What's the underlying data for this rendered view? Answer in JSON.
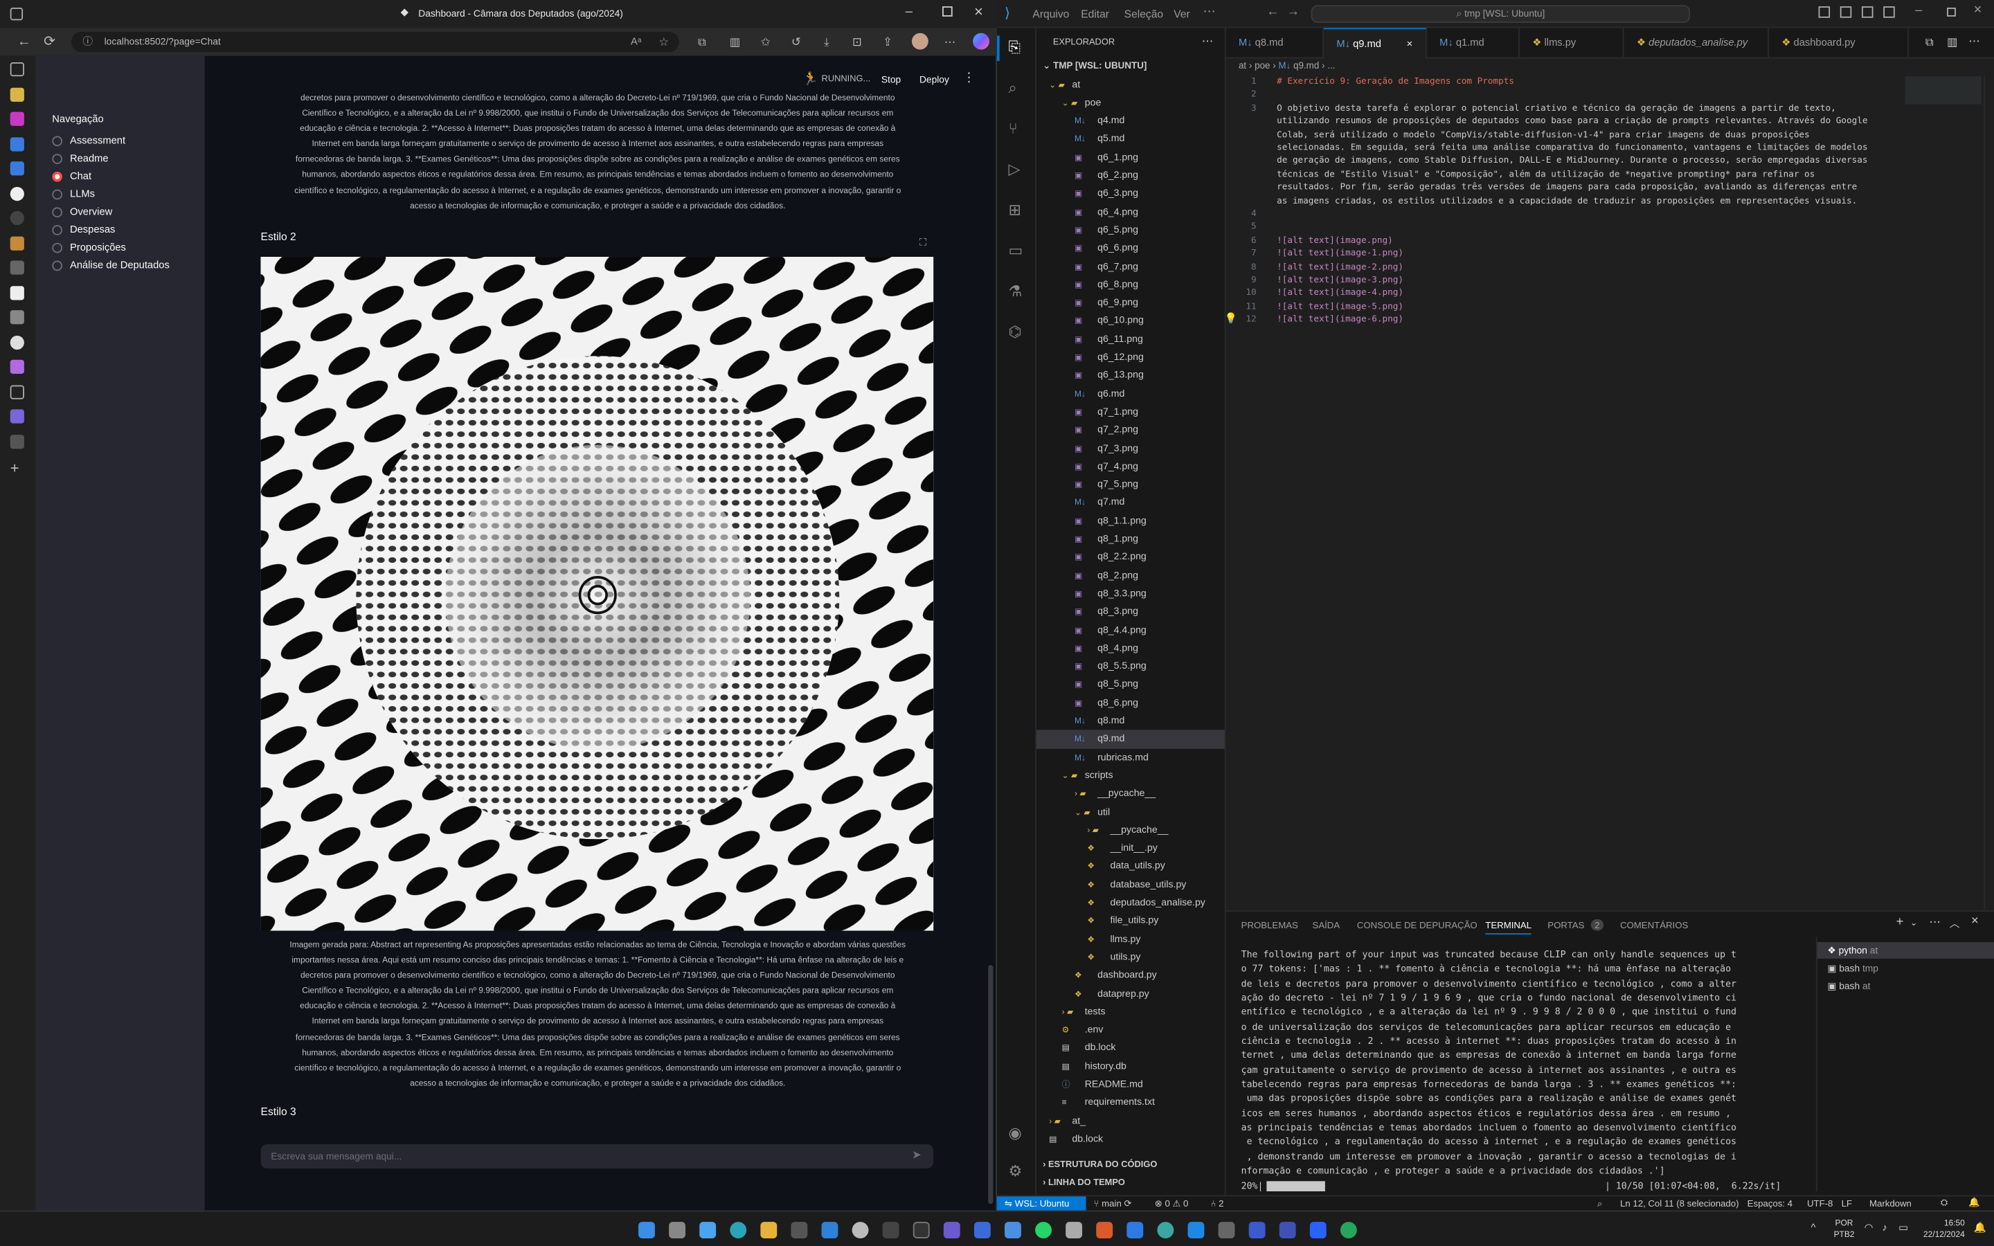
{
  "edge": {
    "title": "Dashboard - Câmara dos Deputados (ago/2024)",
    "url": "localhost:8502/?page=Chat",
    "window_controls": [
      "minimize",
      "maximize",
      "close"
    ]
  },
  "streamlit": {
    "status": "RUNNING...",
    "stop_label": "Stop",
    "deploy_label": "Deploy",
    "nav_title": "Navegação",
    "nav_items": [
      {
        "label": "Assessment",
        "selected": false
      },
      {
        "label": "Readme",
        "selected": false
      },
      {
        "label": "Chat",
        "selected": true
      },
      {
        "label": "LLMs",
        "selected": false
      },
      {
        "label": "Overview",
        "selected": false
      },
      {
        "label": "Despesas",
        "selected": false
      },
      {
        "label": "Proposições",
        "selected": false
      },
      {
        "label": "Análise de Deputados",
        "selected": false
      }
    ],
    "top_paragraph": [
      "decretos para promover o desenvolvimento científico e tecnológico, como a alteração do Decreto-Lei nº 719/1969, que cria o Fundo Nacional de Desenvolvimento",
      "Científico e Tecnológico, e a alteração da Lei nº 9.998/2000, que institui o Fundo de Universalização dos Serviços de Telecomunicações para aplicar recursos em",
      "educação e ciência e tecnologia. 2. **Acesso à Internet**: Duas proposições tratam do acesso à Internet, uma delas determinando que as empresas de conexão à",
      "Internet em banda larga forneçam gratuitamente o serviço de provimento de acesso à Internet aos assinantes, e outra estabelecendo regras para empresas",
      "fornecedoras de banda larga. 3. **Exames Genéticos**: Uma das proposições dispõe sobre as condições para a realização e análise de exames genéticos em seres",
      "humanos, abordando aspectos éticos e regulatórios dessa área. Em resumo, as principais tendências e temas abordados incluem o fomento ao desenvolvimento",
      "científico e tecnológico, a regulamentação do acesso à Internet, e a regulação de exames genéticos, demonstrando um interesse em promover a inovação, garantir o",
      "acesso a tecnologias de informação e comunicação, e proteger a saúde e a privacidade dos cidadãos."
    ],
    "section2_title": "Estilo 2",
    "caption": [
      "Imagem gerada para: Abstract art representing As proposições apresentadas estão relacionadas ao tema de Ciência, Tecnologia e Inovação e abordam várias questões",
      "importantes nessa área. Aqui está um resumo conciso das principais tendências e temas: 1. **Fomento à Ciência e Tecnologia**: Há uma ênfase na alteração de leis e",
      "decretos para promover o desenvolvimento científico e tecnológico, como a alteração do Decreto-Lei nº 719/1969, que cria o Fundo Nacional de Desenvolvimento",
      "Científico e Tecnológico, e a alteração da Lei nº 9.998/2000, que institui o Fundo de Universalização dos Serviços de Telecomunicações para aplicar recursos em",
      "educação e ciência e tecnologia. 2. **Acesso à Internet**: Duas proposições tratam do acesso à Internet, uma delas determinando que as empresas de conexão à",
      "Internet em banda larga forneçam gratuitamente o serviço de provimento de acesso à Internet aos assinantes, e outra estabelecendo regras para empresas",
      "fornecedoras de banda larga. 3. **Exames Genéticos**: Uma das proposições dispõe sobre as condições para a realização e análise de exames genéticos em seres",
      "humanos, abordando aspectos éticos e regulatórios dessa área. Em resumo, as principais tendências e temas abordados incluem o fomento ao desenvolvimento",
      "científico e tecnológico, a regulamentação do acesso à Internet, e a regulação de exames genéticos, demonstrando um interesse em promover a inovação, garantir o",
      "acesso a tecnologias de informação e comunicação, e proteger a saúde e a privacidade dos cidadãos."
    ],
    "section3_title": "Estilo 3",
    "chat_placeholder": "Escreva sua mensagem aqui..."
  },
  "vscode": {
    "menu": [
      "Arquivo",
      "Editar",
      "Seleção",
      "Ver"
    ],
    "search": "tmp [WSL: Ubuntu]",
    "explorer_title": "EXPLORADOR",
    "workspace": "TMP [WSL: UBUNTU]",
    "tree": [
      {
        "label": "at",
        "depth": 0,
        "kind": "folder-open"
      },
      {
        "label": "poe",
        "depth": 1,
        "kind": "folder-open"
      },
      {
        "label": "q4.md",
        "depth": 2,
        "kind": "md"
      },
      {
        "label": "q5.md",
        "depth": 2,
        "kind": "md"
      },
      {
        "label": "q6_1.png",
        "depth": 2,
        "kind": "png"
      },
      {
        "label": "q6_2.png",
        "depth": 2,
        "kind": "png"
      },
      {
        "label": "q6_3.png",
        "depth": 2,
        "kind": "png"
      },
      {
        "label": "q6_4.png",
        "depth": 2,
        "kind": "png"
      },
      {
        "label": "q6_5.png",
        "depth": 2,
        "kind": "png"
      },
      {
        "label": "q6_6.png",
        "depth": 2,
        "kind": "png"
      },
      {
        "label": "q6_7.png",
        "depth": 2,
        "kind": "png"
      },
      {
        "label": "q6_8.png",
        "depth": 2,
        "kind": "png"
      },
      {
        "label": "q6_9.png",
        "depth": 2,
        "kind": "png"
      },
      {
        "label": "q6_10.png",
        "depth": 2,
        "kind": "png"
      },
      {
        "label": "q6_11.png",
        "depth": 2,
        "kind": "png"
      },
      {
        "label": "q6_12.png",
        "depth": 2,
        "kind": "png"
      },
      {
        "label": "q6_13.png",
        "depth": 2,
        "kind": "png"
      },
      {
        "label": "q6.md",
        "depth": 2,
        "kind": "md"
      },
      {
        "label": "q7_1.png",
        "depth": 2,
        "kind": "png"
      },
      {
        "label": "q7_2.png",
        "depth": 2,
        "kind": "png"
      },
      {
        "label": "q7_3.png",
        "depth": 2,
        "kind": "png"
      },
      {
        "label": "q7_4.png",
        "depth": 2,
        "kind": "png"
      },
      {
        "label": "q7_5.png",
        "depth": 2,
        "kind": "png"
      },
      {
        "label": "q7.md",
        "depth": 2,
        "kind": "md"
      },
      {
        "label": "q8_1.1.png",
        "depth": 2,
        "kind": "png"
      },
      {
        "label": "q8_1.png",
        "depth": 2,
        "kind": "png"
      },
      {
        "label": "q8_2.2.png",
        "depth": 2,
        "kind": "png"
      },
      {
        "label": "q8_2.png",
        "depth": 2,
        "kind": "png"
      },
      {
        "label": "q8_3.3.png",
        "depth": 2,
        "kind": "png"
      },
      {
        "label": "q8_3.png",
        "depth": 2,
        "kind": "png"
      },
      {
        "label": "q8_4.4.png",
        "depth": 2,
        "kind": "png"
      },
      {
        "label": "q8_4.png",
        "depth": 2,
        "kind": "png"
      },
      {
        "label": "q8_5.5.png",
        "depth": 2,
        "kind": "png"
      },
      {
        "label": "q8_5.png",
        "depth": 2,
        "kind": "png"
      },
      {
        "label": "q8_6.png",
        "depth": 2,
        "kind": "png"
      },
      {
        "label": "q8.md",
        "depth": 2,
        "kind": "md"
      },
      {
        "label": "q9.md",
        "depth": 2,
        "kind": "md",
        "selected": true
      },
      {
        "label": "rubricas.md",
        "depth": 2,
        "kind": "md"
      },
      {
        "label": "scripts",
        "depth": 1,
        "kind": "folder-open"
      },
      {
        "label": "__pycache__",
        "depth": 2,
        "kind": "folder"
      },
      {
        "label": "util",
        "depth": 2,
        "kind": "folder-open"
      },
      {
        "label": "__pycache__",
        "depth": 3,
        "kind": "folder"
      },
      {
        "label": "__init__.py",
        "depth": 3,
        "kind": "py"
      },
      {
        "label": "data_utils.py",
        "depth": 3,
        "kind": "py"
      },
      {
        "label": "database_utils.py",
        "depth": 3,
        "kind": "py"
      },
      {
        "label": "deputados_analise.py",
        "depth": 3,
        "kind": "py"
      },
      {
        "label": "file_utils.py",
        "depth": 3,
        "kind": "py"
      },
      {
        "label": "llms.py",
        "depth": 3,
        "kind": "py"
      },
      {
        "label": "utils.py",
        "depth": 3,
        "kind": "py"
      },
      {
        "label": "dashboard.py",
        "depth": 2,
        "kind": "py"
      },
      {
        "label": "dataprep.py",
        "depth": 2,
        "kind": "py"
      },
      {
        "label": "tests",
        "depth": 1,
        "kind": "folder"
      },
      {
        "label": ".env",
        "depth": 1,
        "kind": "env"
      },
      {
        "label": "db.lock",
        "depth": 1,
        "kind": "lock"
      },
      {
        "label": "history.db",
        "depth": 1,
        "kind": "db"
      },
      {
        "label": "README.md",
        "depth": 1,
        "kind": "info"
      },
      {
        "label": "requirements.txt",
        "depth": 1,
        "kind": "txt"
      },
      {
        "label": "at_",
        "depth": 0,
        "kind": "folder"
      },
      {
        "label": "db.lock",
        "depth": 0,
        "kind": "lock"
      }
    ],
    "outline_label": "ESTRUTURA DO CÓDIGO",
    "timeline_label": "LINHA DO TEMPO",
    "tabs": [
      {
        "label": "q8.md",
        "active": false
      },
      {
        "label": "q9.md",
        "active": true
      },
      {
        "label": "q1.md",
        "active": false
      },
      {
        "label": "llms.py",
        "active": false
      },
      {
        "label": "deputados_analise.py",
        "active": false
      },
      {
        "label": "dashboard.py",
        "active": false
      }
    ],
    "breadcrumb": [
      "at",
      "poe",
      "q9.md",
      "..."
    ],
    "code": [
      {
        "n": "1",
        "text": "# Exercício 9: Geração de Imagens com Prompts"
      },
      {
        "n": "2",
        "text": ""
      },
      {
        "n": "3",
        "text": "O objetivo desta tarefa é explorar o potencial criativo e técnico da geração de imagens a partir de texto,"
      },
      {
        "n": "",
        "text": "utilizando resumos de proposições de deputados como base para a criação de prompts relevantes. Através do Google"
      },
      {
        "n": "",
        "text": "Colab, será utilizado o modelo \"CompVis/stable-diffusion-v1-4\" para criar imagens de duas proposições"
      },
      {
        "n": "",
        "text": "selecionadas. Em seguida, será feita uma análise comparativa do funcionamento, vantagens e limitações de modelos"
      },
      {
        "n": "",
        "text": "de geração de imagens, como Stable Diffusion, DALL-E e MidJourney. Durante o processo, serão empregadas diversas"
      },
      {
        "n": "",
        "text": "técnicas de \"Estilo Visual\" e \"Composição\", além da utilização de *negative prompting* para refinar os"
      },
      {
        "n": "",
        "text": "resultados. Por fim, serão geradas três versões de imagens para cada proposição, avaliando as diferenças entre"
      },
      {
        "n": "",
        "text": "as imagens criadas, os estilos utilizados e a capacidade de traduzir as proposições em representações visuais."
      },
      {
        "n": "4",
        "text": ""
      },
      {
        "n": "5",
        "text": ""
      },
      {
        "n": "6",
        "text": "![alt text](image.png)"
      },
      {
        "n": "7",
        "text": "![alt text](image-1.png)"
      },
      {
        "n": "8",
        "text": "![alt text](image-2.png)"
      },
      {
        "n": "9",
        "text": "![alt text](image-3.png)"
      },
      {
        "n": "10",
        "text": "![alt text](image-4.png)"
      },
      {
        "n": "11",
        "text": "![alt text](image-5.png)"
      },
      {
        "n": "12",
        "text": "![alt text](image-6.png)"
      }
    ],
    "panel_tabs": [
      "PROBLEMAS",
      "SAÍDA",
      "CONSOLE DE DEPURAÇÃO",
      "TERMINAL",
      "PORTAS",
      "COMENTÁRIOS"
    ],
    "ports_count": "2",
    "terminal_lines": [
      "The following part of your input was truncated because CLIP can only handle sequences up t",
      "o 77 tokens: ['mas : 1 . ** fomento à ciência e tecnologia **: há uma ênfase na alteração",
      "de leis e decretos para promover o desenvolvimento científico e tecnológico , como a alter",
      "ação do decreto - lei nº 7 1 9 / 1 9 6 9 , que cria o fundo nacional de desenvolvimento ci",
      "entífico e tecnológico , e a alteração da lei nº 9 . 9 9 8 / 2 0 0 0 , que institui o fund",
      "o de universalização dos serviços de telecomunicações para aplicar recursos em educação e",
      "ciência e tecnologia . 2 . ** acesso à internet **: duas proposições tratam do acesso à in",
      "ternet , uma delas determinando que as empresas de conexão à internet em banda larga forne",
      "çam gratuitamente o serviço de provimento de acesso à internet aos assinantes , e outra es",
      "tabelecendo regras para empresas fornecedoras de banda larga . 3 . ** exames genéticos **:",
      " uma das proposições dispõe sobre as condições para a realização e análise de exames genét",
      "icos em seres humanos , abordando aspectos éticos e regulatórios dessa área . em resumo ,",
      "as principais tendências e temas abordados incluem o fomento ao desenvolvimento científico",
      " e tecnológico , a regulamentação do acesso à internet , e a regulação de exames genéticos",
      " , demonstrando um interesse em promover a inovação , garantir o acesso a tecnologias de i",
      "nformação e comunicação , e proteger a saúde e a privacidade dos cidadãos .']"
    ],
    "progress_percent_label": "20%|",
    "progress_fraction": 0.2,
    "progress_stats": "| 10/50 [01:07<04:08,  6.22s/it]",
    "terminals": [
      {
        "name": "python",
        "cwd": "at"
      },
      {
        "name": "bash",
        "cwd": "tmp"
      },
      {
        "name": "bash",
        "cwd": "at"
      }
    ],
    "status": {
      "remote": "WSL: Ubuntu",
      "branch": "main",
      "errors": "0",
      "warnings": "0",
      "ports": "2",
      "cursor": "Ln 12, Col 11 (8 selecionado)",
      "spaces": "Espaços: 4",
      "encoding": "UTF-8",
      "eol": "LF",
      "language": "Markdown"
    }
  },
  "taskbar": {
    "lang": "POR",
    "layout": "PTB2",
    "time": "16:50",
    "date": "22/12/2024"
  },
  "colors": {
    "accent_red": "#ff4b4b",
    "vscode_blue": "#0078d4",
    "md_heading": "#e06c5c",
    "md_link": "#c586c0"
  }
}
